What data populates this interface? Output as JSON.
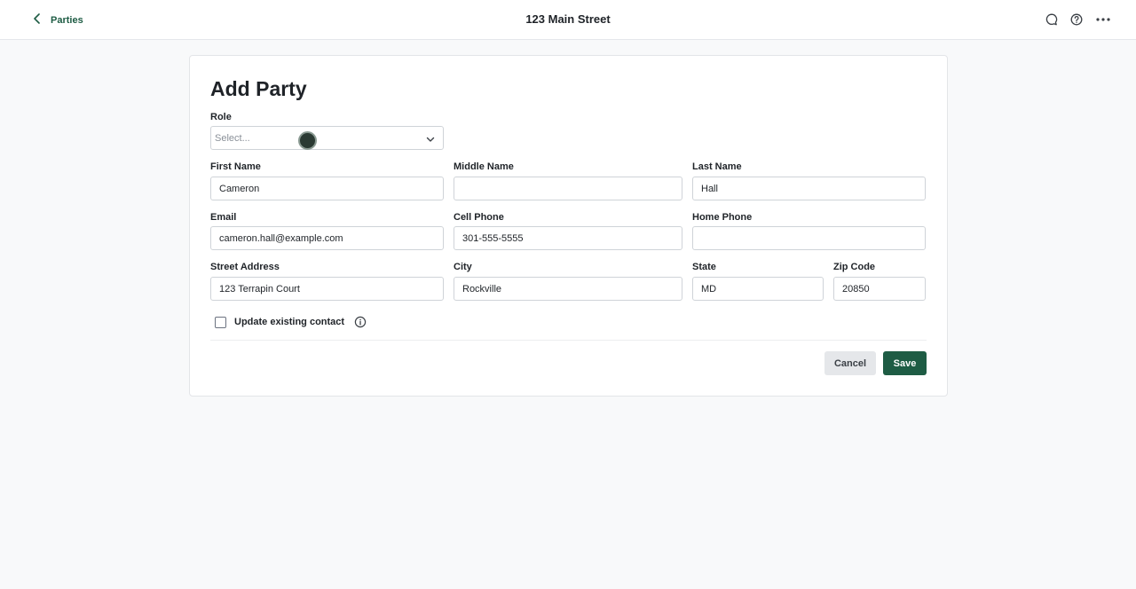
{
  "header": {
    "back_label": "Parties",
    "title": "123 Main Street",
    "icons": [
      "chat-icon",
      "help-icon",
      "more-icon"
    ]
  },
  "form": {
    "title": "Add Party",
    "role": {
      "label": "Role",
      "placeholder": "Select..."
    },
    "first_name": {
      "label": "First Name",
      "value": "Cameron"
    },
    "middle_name": {
      "label": "Middle Name",
      "value": ""
    },
    "last_name": {
      "label": "Last Name",
      "value": "Hall"
    },
    "email": {
      "label": "Email",
      "value": "cameron.hall@example.com"
    },
    "cell_phone": {
      "label": "Cell Phone",
      "value": "301-555-5555"
    },
    "home_phone": {
      "label": "Home Phone",
      "value": ""
    },
    "street": {
      "label": "Street Address",
      "value": "123 Terrapin Court"
    },
    "city": {
      "label": "City",
      "value": "Rockville"
    },
    "state": {
      "label": "State",
      "value": "MD"
    },
    "zip": {
      "label": "Zip Code",
      "value": "20850"
    },
    "update_contact": {
      "label": "Update existing contact",
      "checked": false
    },
    "cancel_label": "Cancel",
    "save_label": "Save"
  },
  "colors": {
    "accent": "#1e5c44",
    "background": "#f8f9fa"
  }
}
